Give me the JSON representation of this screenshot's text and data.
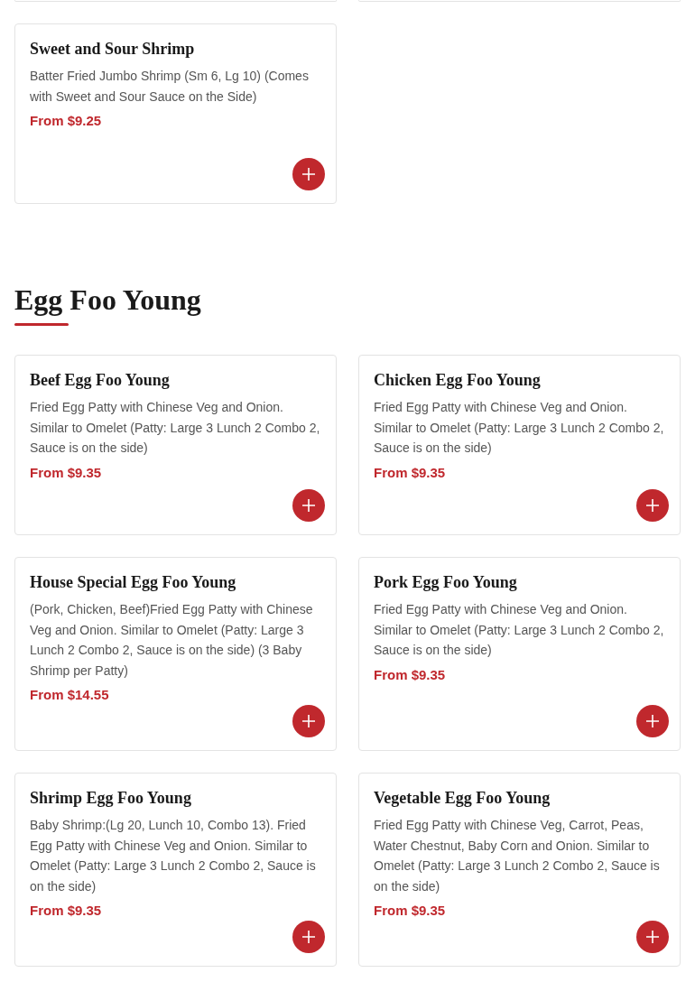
{
  "cut_off_cards": [
    {
      "kind": "card"
    },
    {
      "kind": "card"
    }
  ],
  "sections": [
    {
      "items": [
        {
          "name": "Sweet and Sour Shrimp",
          "description": "Batter Fried Jumbo Shrimp (Sm 6, Lg 10) (Comes with Sweet and Sour Sauce on the Side)",
          "price": "From $9.25"
        }
      ]
    },
    {
      "title": "Egg Foo Young",
      "items": [
        {
          "name": "Beef Egg Foo Young",
          "description": "Fried Egg Patty with Chinese Veg and Onion. Similar to Omelet (Patty: Large 3 Lunch 2 Combo 2, Sauce is on the side)",
          "price": "From $9.35"
        },
        {
          "name": "Chicken Egg Foo Young",
          "description": "Fried Egg Patty with Chinese Veg and Onion. Similar to Omelet (Patty: Large 3 Lunch 2 Combo 2, Sauce is on the side)",
          "price": "From $9.35"
        },
        {
          "name": "House Special Egg Foo Young",
          "description": "(Pork, Chicken, Beef)Fried Egg Patty with Chinese Veg and Onion. Similar to Omelet (Patty: Large 3 Lunch 2 Combo 2, Sauce is on the side) (3 Baby Shrimp per Patty)",
          "price": "From $14.55"
        },
        {
          "name": "Pork Egg Foo Young",
          "description": "Fried Egg Patty with Chinese Veg and Onion. Similar to Omelet (Patty: Large 3 Lunch 2 Combo 2, Sauce is on the side)",
          "price": "From $9.35"
        },
        {
          "name": "Shrimp Egg Foo Young",
          "description": "Baby Shrimp:(Lg 20, Lunch 10, Combo 13). Fried Egg Patty with Chinese Veg and Onion. Similar to Omelet (Patty: Large 3 Lunch 2 Combo 2, Sauce is on the side)",
          "price": "From $9.35"
        },
        {
          "name": "Vegetable Egg Foo Young",
          "description": "Fried Egg Patty with Chinese Veg, Carrot, Peas, Water Chestnut, Baby Corn and Onion. Similar to Omelet (Patty: Large 3 Lunch 2 Combo 2, Sauce is on the side)",
          "price": "From $9.35"
        }
      ]
    }
  ]
}
